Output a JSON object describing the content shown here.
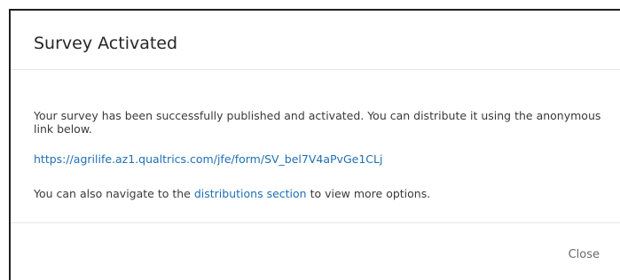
{
  "dialog": {
    "title": "Survey Activated",
    "message": "Your survey has been successfully published and activated. You can distribute it using the anonymous link below.",
    "survey_link": "https://agrilife.az1.qualtrics.com/jfe/form/SV_bel7V4aPvGe1CLj",
    "nav_prefix": "You can also navigate to the ",
    "nav_link": "distributions section",
    "nav_suffix": " to view more options.",
    "close_label": "Close"
  },
  "colors": {
    "link": "#1f6fb5",
    "border": "#1f1f1f",
    "divider": "#e6e6e6",
    "close_text": "#6b6b6b"
  }
}
